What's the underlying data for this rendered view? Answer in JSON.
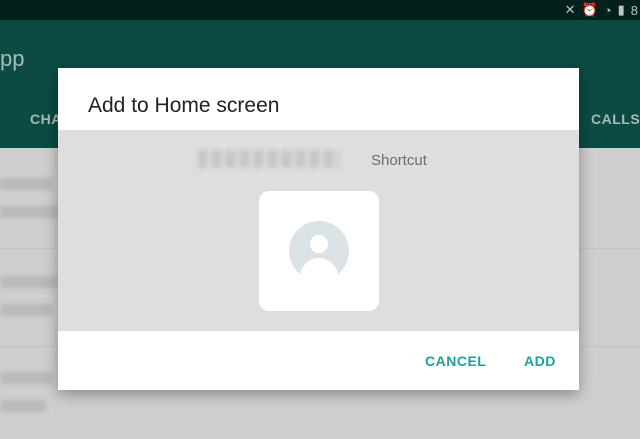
{
  "status_bar": {
    "battery_text": "8"
  },
  "app": {
    "title": "pp",
    "tabs": [
      "CHA",
      "CALLS"
    ]
  },
  "dialog": {
    "title": "Add to Home screen",
    "shortcut_label": "Shortcut",
    "shortcut_icon": "contact-avatar-icon",
    "buttons": {
      "cancel": "CANCEL",
      "add": "ADD"
    },
    "accent_color": "#1aa29b"
  },
  "colors": {
    "app_bar": "#0b4b44",
    "status_bar": "#04201c"
  }
}
